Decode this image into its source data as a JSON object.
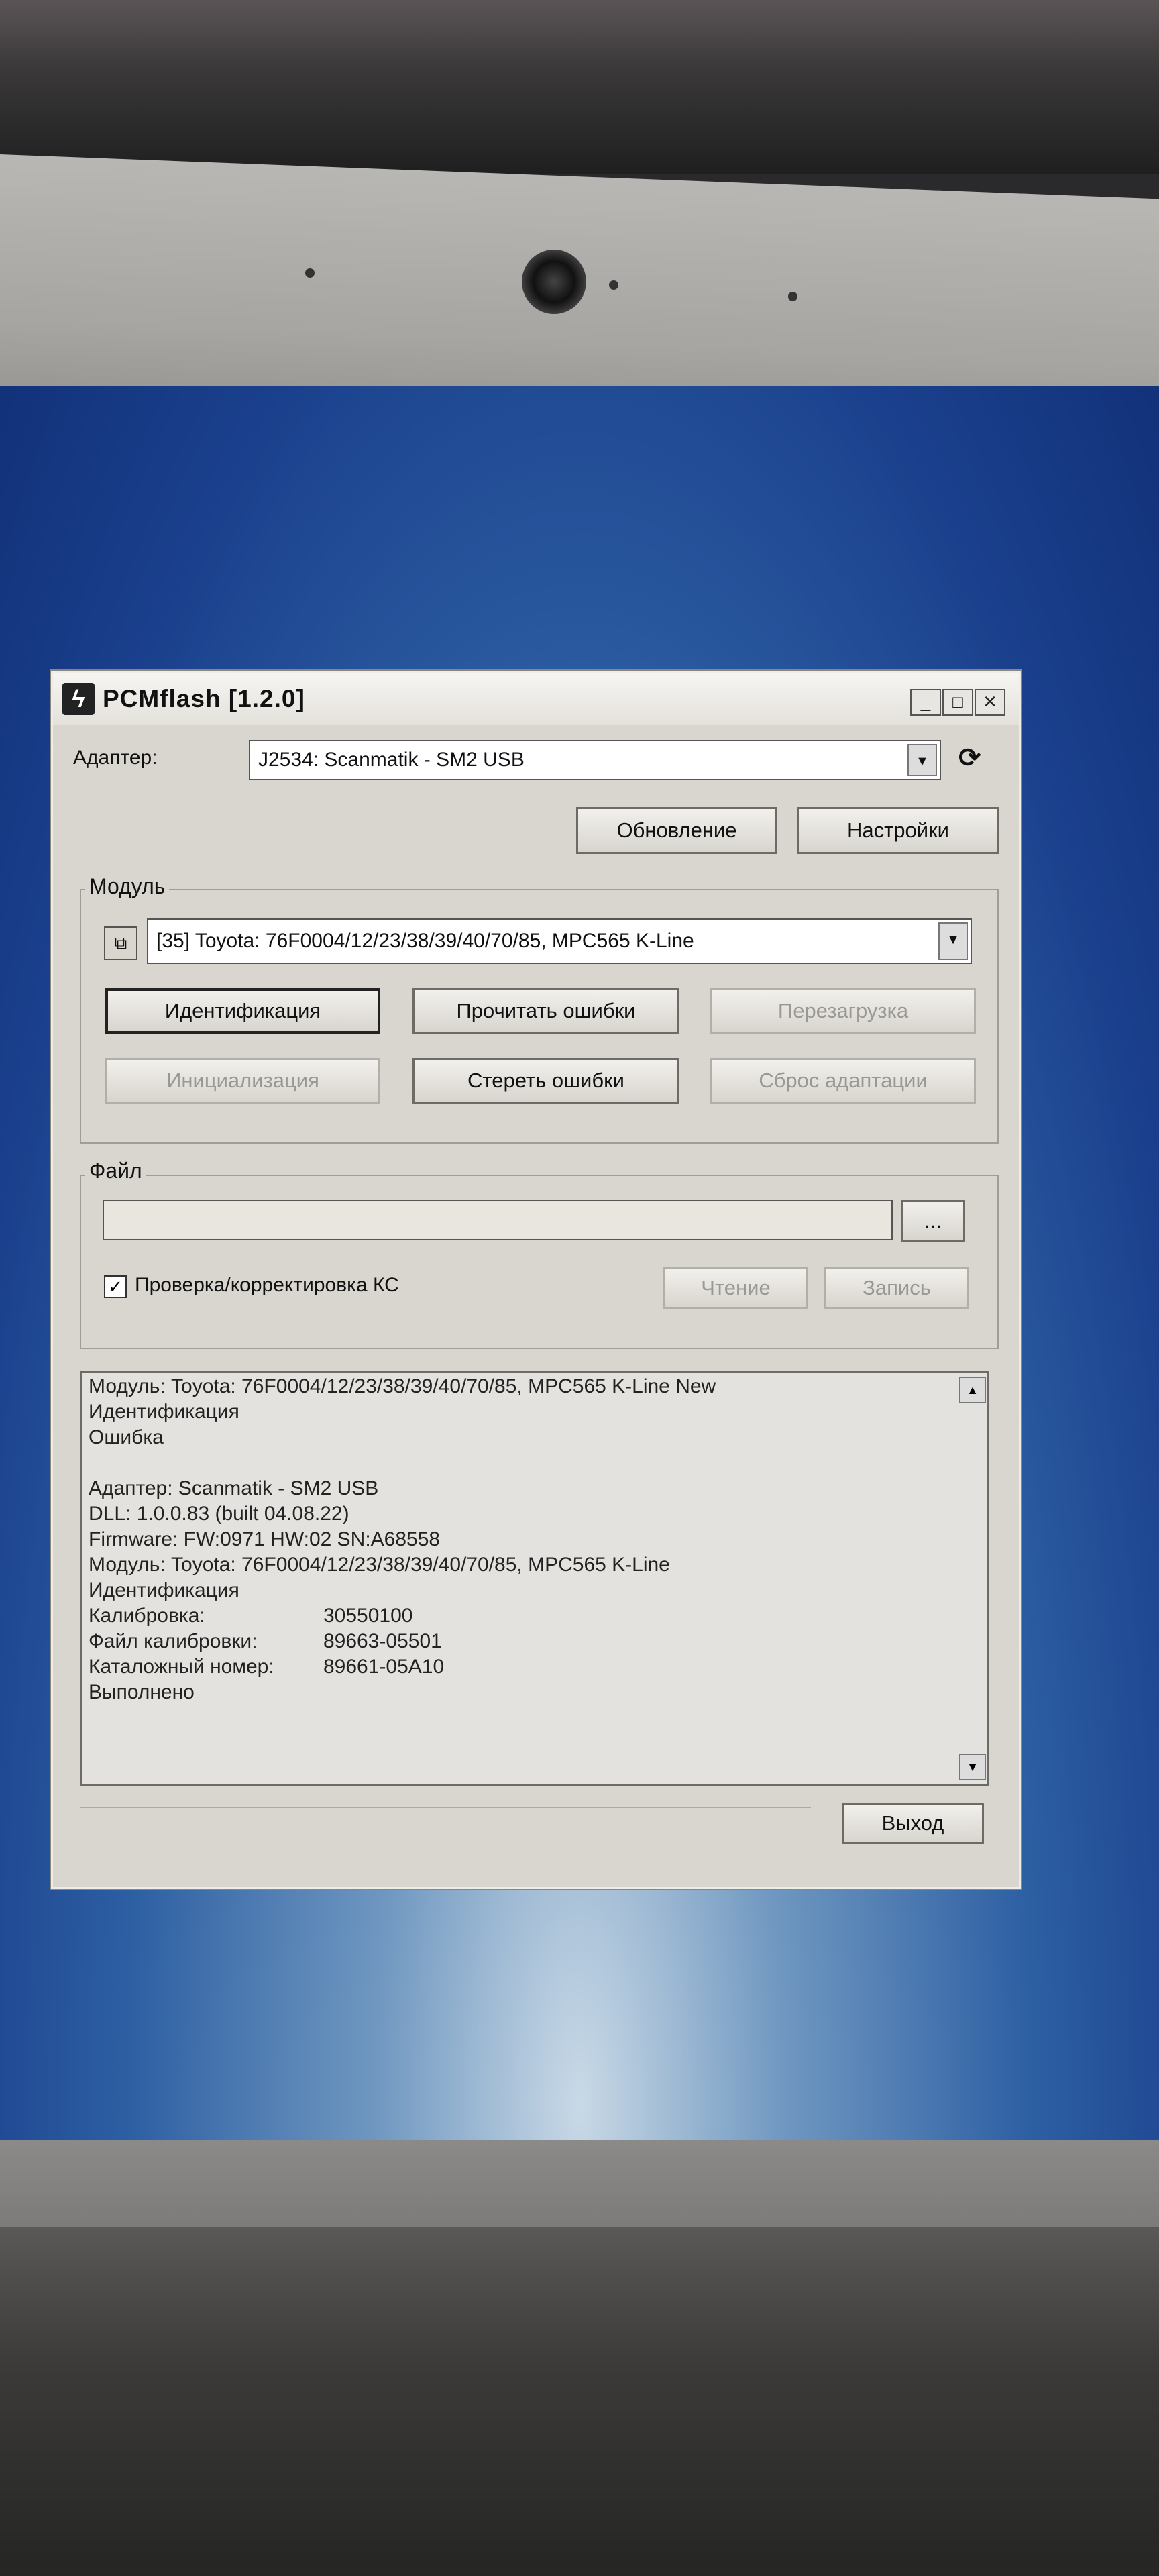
{
  "window": {
    "title": "PCMflash [1.2.0]",
    "controls": [
      "_",
      "□",
      "✕"
    ]
  },
  "adapter": {
    "label": "Адаптер:",
    "value": "J2534: Scanmatik - SM2 USB"
  },
  "top_buttons": {
    "update": "Обновление",
    "settings": "Настройки"
  },
  "module_group": {
    "title": "Модуль",
    "value": "[35] Toyota: 76F0004/12/23/38/39/40/70/85, MPC565 K-Line",
    "buttons": {
      "identify": "Идентификация",
      "read_errors": "Прочитать ошибки",
      "reboot": "Перезагрузка",
      "init": "Инициализация",
      "clear_errors": "Стереть ошибки",
      "reset_adapt": "Сброс адаптации"
    }
  },
  "file_group": {
    "title": "Файл",
    "path": "",
    "browse": "...",
    "checksum_label": "Проверка/корректировка КС",
    "checksum_checked": true,
    "read": "Чтение",
    "write": "Запись"
  },
  "log": {
    "lines": [
      "Модуль: Toyota: 76F0004/12/23/38/39/40/70/85, MPC565 K-Line New",
      "Идентификация",
      "Ошибка",
      "",
      "Адаптер: Scanmatik - SM2 USB",
      "DLL: 1.0.0.83 (built 04.08.22)",
      "Firmware: FW:0971 HW:02 SN:A68558",
      "Модуль: Toyota: 76F0004/12/23/38/39/40/70/85, MPC565 K-Line",
      "Идентификация"
    ],
    "rows": [
      {
        "key": "Калибровка:",
        "value": "30550100"
      },
      {
        "key": "Файл калибровки:",
        "value": "89663-05501"
      },
      {
        "key": "Каталожный номер:",
        "value": "89661-05A10"
      }
    ],
    "final": "Выполнено"
  },
  "exit_label": "Выход",
  "icons": [
    "pcmflash-logo-icon",
    "refresh-icon",
    "module-window-icon",
    "dropdown-arrow-icon",
    "scroll-up-icon",
    "scroll-down-icon"
  ]
}
